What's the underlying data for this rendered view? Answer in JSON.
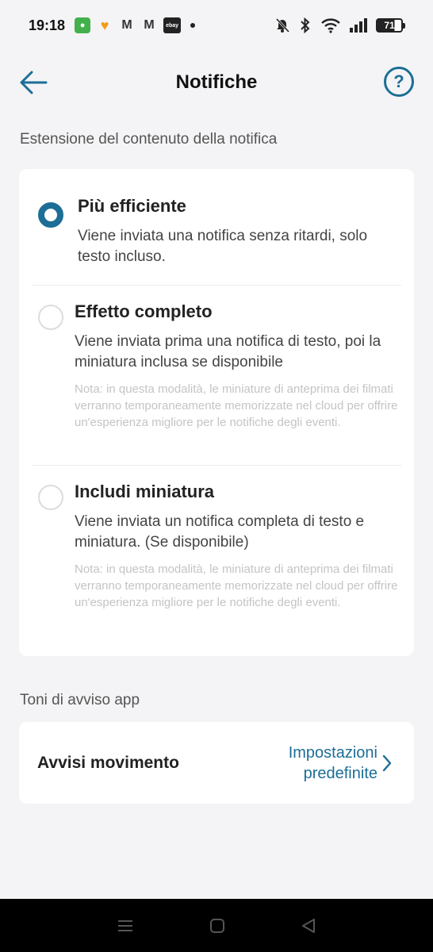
{
  "status_bar": {
    "time": "19:18",
    "battery": "71",
    "mail_glyph": "M",
    "ebay_label": "ebay"
  },
  "header": {
    "title": "Notifiche",
    "help_glyph": "?"
  },
  "section_notification": {
    "label": "Estensione del contenuto della notifica",
    "options": [
      {
        "title": "Più efficiente",
        "desc": "Viene inviata una notifica senza ritardi, solo testo incluso.",
        "selected": true
      },
      {
        "title": "Effetto completo",
        "desc": "Viene inviata prima una notifica di testo, poi la miniatura inclusa se disponibile",
        "note": "Nota: in questa modalità, le miniature di anteprima dei filmati verranno temporaneamente memorizzate nel cloud per offrire un'esperienza migliore per le notifiche degli eventi.",
        "selected": false
      },
      {
        "title": "Includi miniatura",
        "desc": "Viene inviata un notifica completa di testo e miniatura. (Se disponibile)",
        "note": "Nota: in questa modalità, le miniature di anteprima dei filmati verranno temporaneamente memorizzate nel cloud per offrire un'esperienza migliore per le notifiche degli eventi.",
        "selected": false
      }
    ]
  },
  "section_tones": {
    "label": "Toni di avviso app",
    "row": {
      "title": "Avvisi movimento",
      "value_line1": "Impostazioni",
      "value_line2": "predefinite"
    }
  },
  "colors": {
    "accent": "#1c6e96",
    "background": "#f4f4f6"
  }
}
